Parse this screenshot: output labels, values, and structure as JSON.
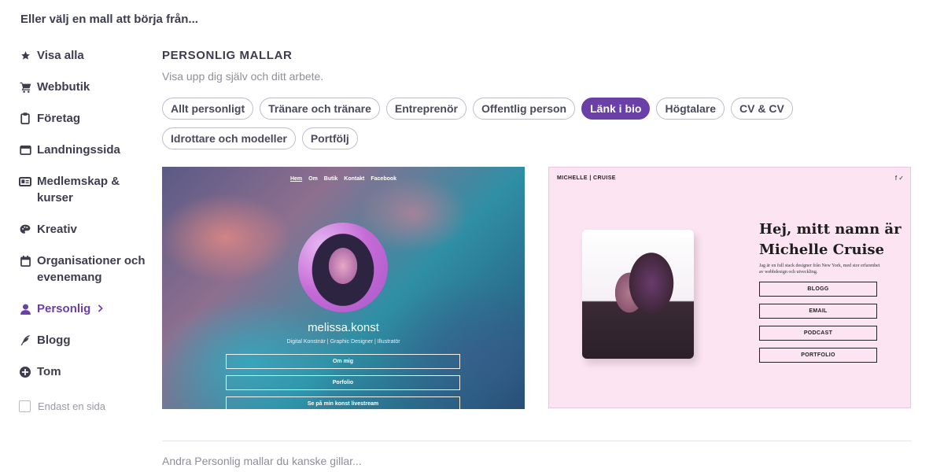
{
  "page_heading": "Eller välj en mall att börja från...",
  "sidebar": {
    "items": [
      {
        "label": "Visa alla",
        "icon": "star-icon"
      },
      {
        "label": "Webbutik",
        "icon": "cart-icon"
      },
      {
        "label": "Företag",
        "icon": "clipboard-icon"
      },
      {
        "label": "Landningssida",
        "icon": "browser-window-icon"
      },
      {
        "label": "Medlemskap & kurser",
        "icon": "id-card-icon"
      },
      {
        "label": "Kreativ",
        "icon": "palette-icon"
      },
      {
        "label": "Organisationer och evenemang",
        "icon": "calendar-icon"
      },
      {
        "label": "Personlig",
        "icon": "person-icon",
        "active": true
      },
      {
        "label": "Blogg",
        "icon": "quill-icon"
      },
      {
        "label": "Tom",
        "icon": "plus-circle-icon"
      }
    ],
    "single_page_label": "Endast en sida",
    "single_page_checked": false
  },
  "main": {
    "title": "PERSONLIG MALLAR",
    "subtitle": "Visa upp dig själv och ditt arbete.",
    "chips": [
      {
        "label": "Allt personligt"
      },
      {
        "label": "Tränare och tränare"
      },
      {
        "label": "Entreprenör"
      },
      {
        "label": "Offentlig person"
      },
      {
        "label": "Länk i bio",
        "active": true
      },
      {
        "label": "Högtalare"
      },
      {
        "label": "CV & CV"
      },
      {
        "label": "Idrottare och modeller"
      },
      {
        "label": "Portfölj"
      }
    ],
    "accent_color": "#6b3fa8"
  },
  "template1": {
    "nav": [
      "Hem",
      "Om",
      "Butik",
      "Kontakt",
      "Facebook"
    ],
    "name": "melissa.konst",
    "bio": "Digital Konstnär | Graphic Designer | Illustratör",
    "buttons": [
      "Om mig",
      "Porfolio",
      "Se på min konst livestream"
    ]
  },
  "template2": {
    "brand": "MICHELLE | CRUISE",
    "social": "f ✓",
    "heading_line1": "Hej, mitt namn är",
    "heading_line2": "Michelle Cruise",
    "description": "Jag är en full stack designer från New York, med stor erfarenhet av webbdesign och utveckling.",
    "buttons": [
      "BLOGG",
      "EMAIL",
      "PODCAST",
      "PORTFOLIO"
    ],
    "background_color": "#fce4f2"
  },
  "footer_text": "Andra Personlig mallar du kanske gillar..."
}
